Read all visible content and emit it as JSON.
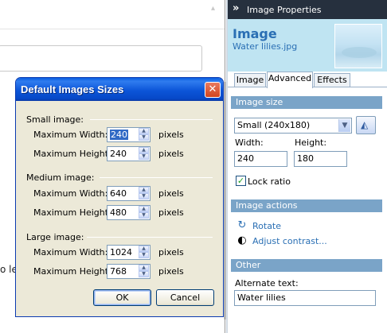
{
  "document": {
    "text_fragment": "o le"
  },
  "panel": {
    "header_title": "Image Properties",
    "hero_title": "Image",
    "hero_subtitle": "Water lilies.jpg",
    "tabs": [
      {
        "label": "Image"
      },
      {
        "label": "Advanced"
      },
      {
        "label": "Effects"
      }
    ],
    "active_tab": "Advanced",
    "image_size": {
      "section_title": "Image size",
      "preset_value": "Small (240x180)",
      "width_label": "Width:",
      "width_value": "240",
      "height_label": "Height:",
      "height_value": "180",
      "lock_ratio_label": "Lock ratio",
      "lock_ratio_checked": true
    },
    "image_actions": {
      "section_title": "Image actions",
      "rotate_label": "Rotate",
      "adjust_label": "Adjust contrast..."
    },
    "other": {
      "section_title": "Other",
      "alt_label": "Alternate text:",
      "alt_value": "Water lilies"
    },
    "colors": {
      "header_bg": "#26303e",
      "hero_bg": "#bfe4f2",
      "section_bg": "#7aa4c8",
      "link": "#2a6fb4"
    }
  },
  "dialog": {
    "title": "Default Images Sizes",
    "groups": [
      {
        "label": "Small image:",
        "rows": [
          {
            "label": "Maximum Width:",
            "value": "240",
            "unit": "pixels"
          },
          {
            "label": "Maximum Height:",
            "value": "240",
            "unit": "pixels"
          }
        ]
      },
      {
        "label": "Medium image:",
        "rows": [
          {
            "label": "Maximum Width:",
            "value": "640",
            "unit": "pixels"
          },
          {
            "label": "Maximum Height:",
            "value": "480",
            "unit": "pixels"
          }
        ]
      },
      {
        "label": "Large image:",
        "rows": [
          {
            "label": "Maximum Width:",
            "value": "1024",
            "unit": "pixels"
          },
          {
            "label": "Maximum Height:",
            "value": "768",
            "unit": "pixels"
          }
        ]
      }
    ],
    "ok_label": "OK",
    "cancel_label": "Cancel",
    "colors": {
      "titlebar": "#0c55d8",
      "close": "#d2441f",
      "face": "#ece9d8"
    }
  }
}
